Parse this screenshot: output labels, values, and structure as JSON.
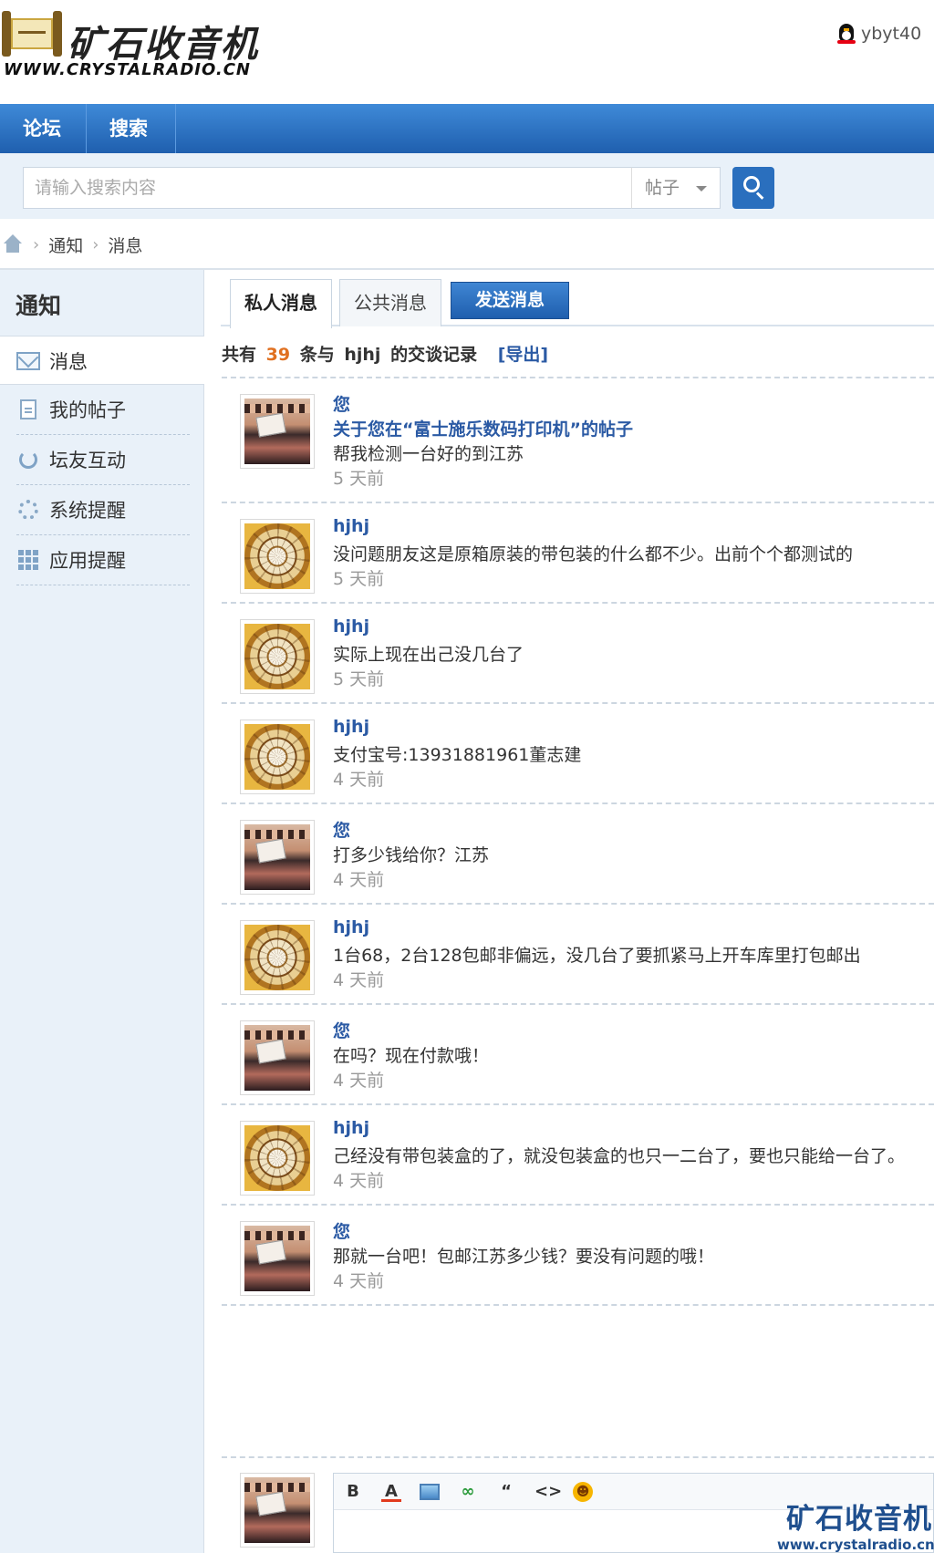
{
  "site": {
    "logo_title": "矿石收音机",
    "logo_subtitle": "WWW.CRYSTALRADIO.CN",
    "username": "ybyt40"
  },
  "nav": {
    "items": [
      "论坛",
      "搜索"
    ]
  },
  "search": {
    "placeholder": "请输入搜索内容",
    "type_selected": "帖子"
  },
  "breadcrumb": {
    "items": [
      "通知",
      "消息"
    ]
  },
  "sidebar": {
    "title": "通知",
    "items": [
      {
        "label": "消息",
        "icon": "mail-icon",
        "active": true
      },
      {
        "label": "我的帖子",
        "icon": "document-icon"
      },
      {
        "label": "坛友互动",
        "icon": "recycle-icon"
      },
      {
        "label": "系统提醒",
        "icon": "gear-icon"
      },
      {
        "label": "应用提醒",
        "icon": "grid-icon"
      }
    ]
  },
  "tabs": {
    "private": "私人消息",
    "public": "公共消息",
    "send": "发送消息"
  },
  "summary": {
    "prefix": "共有",
    "count": "39",
    "mid": "条与",
    "user": "hjhj",
    "suffix": "的交谈记录",
    "export": "[导出]"
  },
  "messages": [
    {
      "sender": "您",
      "avatar": "group-photo",
      "subject": "关于您在“富士施乐数码打印机”的帖子",
      "text": "帮我检测一台好的到江苏",
      "time": "5 天前"
    },
    {
      "sender": "hjhj",
      "avatar": "dome-photo",
      "text": "没问题朋友这是原箱原装的带包装的什么都不少。出前个个都测试的",
      "time": "5 天前"
    },
    {
      "sender": "hjhj",
      "avatar": "dome-photo",
      "text": "实际上现在出己没几台了",
      "time": "5 天前"
    },
    {
      "sender": "hjhj",
      "avatar": "dome-photo",
      "text": "支付宝号:13931881961董志建",
      "time": "4 天前"
    },
    {
      "sender": "您",
      "avatar": "group-photo",
      "text": "打多少钱给你？江苏",
      "time": "4 天前"
    },
    {
      "sender": "hjhj",
      "avatar": "dome-photo",
      "text": "1台68，2台128包邮非偏远，没几台了要抓紧马上开车库里打包邮出",
      "time": "4 天前"
    },
    {
      "sender": "您",
      "avatar": "group-photo",
      "text": "在吗？现在付款哦！",
      "time": "4 天前"
    },
    {
      "sender": "hjhj",
      "avatar": "dome-photo",
      "text": "己经没有带包装盒的了，就没包装盒的也只一二台了，要也只能给一台了。",
      "time": "4 天前"
    },
    {
      "sender": "您",
      "avatar": "group-photo",
      "text": "那就一台吧！包邮江苏多少钱？要没有问题的哦！",
      "time": "4 天前"
    }
  ],
  "editor": {
    "toolbar": [
      "B",
      "A",
      "image",
      "link",
      "“",
      "<>",
      "smiley"
    ]
  },
  "watermark": {
    "title": "矿石收音机",
    "url": "www.crystalradio.cn"
  }
}
